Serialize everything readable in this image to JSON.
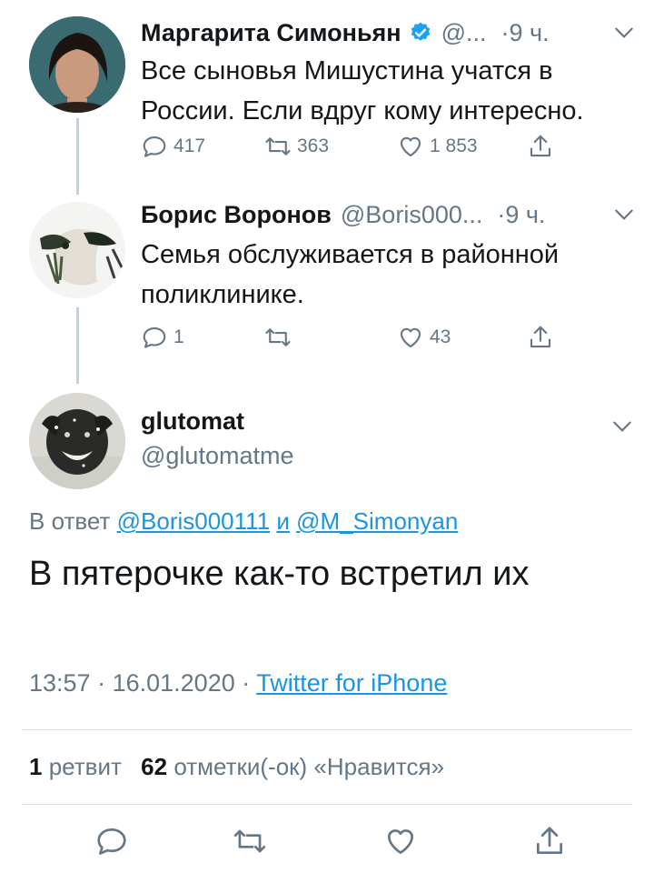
{
  "tweet1": {
    "name": "Маргарита Симоньян",
    "handle": "@...",
    "time": "·9 ч.",
    "text": "Все сыновья Мишустина учатся в России. Если вдруг кому интересно.",
    "replies": "417",
    "retweets": "363",
    "likes": "1 853",
    "icons": {
      "verified": "verified-badge-icon",
      "more": "chevron-down-icon"
    }
  },
  "tweet2": {
    "name": "Борис Воронов",
    "handle": "@Boris000...",
    "time": "·9 ч.",
    "text": "Семья обслуживается в районной поликлинике.",
    "replies": "1",
    "retweets": "",
    "likes": "43"
  },
  "main": {
    "name": "glutomat",
    "handle": "@glutomatme",
    "reply_prefix": "В ответ",
    "reply_user1": "@Boris000111",
    "reply_and": "и",
    "reply_user2": "@M_Simonyan",
    "text": "В пятерочке как-то встретил их",
    "time": "13:57",
    "date": "16.01.2020",
    "source": "Twitter for iPhone",
    "retweet_count": "1",
    "retweet_label": "ретвит",
    "like_count": "62",
    "like_label": "отметки(-ок) «Нравится»"
  },
  "colors": {
    "accent": "#1b95e0",
    "verified": "#1da1f2",
    "muted": "#657786"
  }
}
